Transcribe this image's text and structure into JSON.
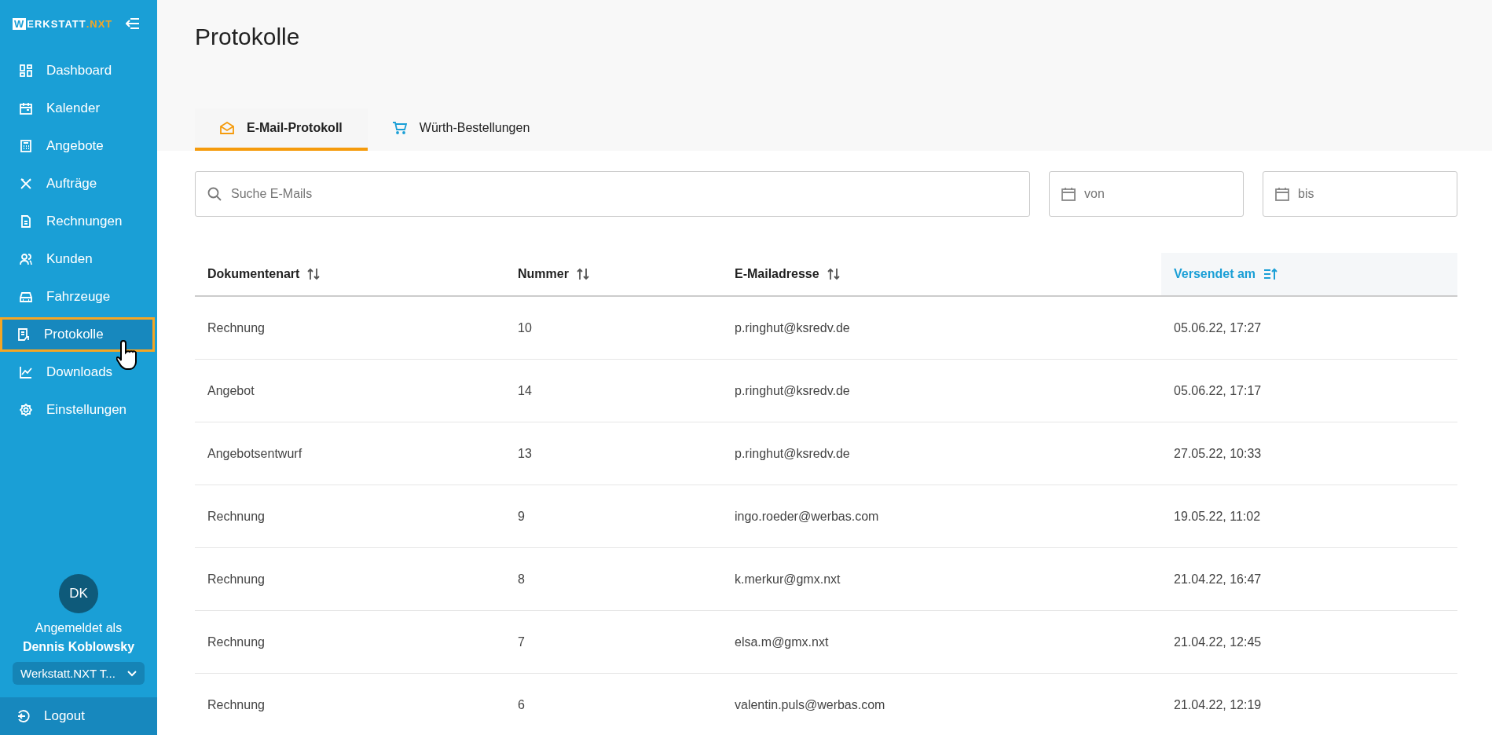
{
  "sidebar": {
    "logo": {
      "first_letter": "W",
      "rest": "ERKSTATT",
      "suffix": ".NXT"
    },
    "items": [
      {
        "label": "Dashboard",
        "selected": false
      },
      {
        "label": "Kalender",
        "selected": false
      },
      {
        "label": "Angebote",
        "selected": false
      },
      {
        "label": "Aufträge",
        "selected": false
      },
      {
        "label": "Rechnungen",
        "selected": false
      },
      {
        "label": "Kunden",
        "selected": false
      },
      {
        "label": "Fahrzeuge",
        "selected": false
      },
      {
        "label": "Protokolle",
        "selected": true
      },
      {
        "label": "Downloads",
        "selected": false
      },
      {
        "label": "Einstellungen",
        "selected": false
      }
    ],
    "user": {
      "initials": "DK",
      "caption": "Angemeldet als",
      "name": "Dennis Koblowsky",
      "workshop": "Werkstatt.NXT T..."
    },
    "logout": "Logout"
  },
  "page": {
    "title": "Protokolle",
    "tabs": [
      {
        "label": "E-Mail-Protokoll",
        "selected": true
      },
      {
        "label": "Würth-Bestellungen",
        "selected": false
      }
    ],
    "search": {
      "placeholder": "Suche E-Mails"
    },
    "date_from": {
      "placeholder": "von"
    },
    "date_to": {
      "placeholder": "bis"
    },
    "table": {
      "columns": [
        {
          "label": "Dokumentenart",
          "sorted": false
        },
        {
          "label": "Nummer",
          "sorted": false
        },
        {
          "label": "E-Mailadresse",
          "sorted": false
        },
        {
          "label": "Versendet am",
          "sorted": true
        }
      ],
      "rows": [
        [
          "Rechnung",
          "10",
          "p.ringhut@ksredv.de",
          "05.06.22, 17:27"
        ],
        [
          "Angebot",
          "14",
          "p.ringhut@ksredv.de",
          "05.06.22, 17:17"
        ],
        [
          "Angebotsentwurf",
          "13",
          "p.ringhut@ksredv.de",
          "27.05.22, 10:33"
        ],
        [
          "Rechnung",
          "9",
          "ingo.roeder@werbas.com",
          "19.05.22, 11:02"
        ],
        [
          "Rechnung",
          "8",
          "k.merkur@gmx.nxt",
          "21.04.22, 16:47"
        ],
        [
          "Rechnung",
          "7",
          "elsa.m@gmx.nxt",
          "21.04.22, 12:45"
        ],
        [
          "Rechnung",
          "6",
          "valentin.puls@werbas.com",
          "21.04.22, 12:19"
        ]
      ]
    }
  }
}
